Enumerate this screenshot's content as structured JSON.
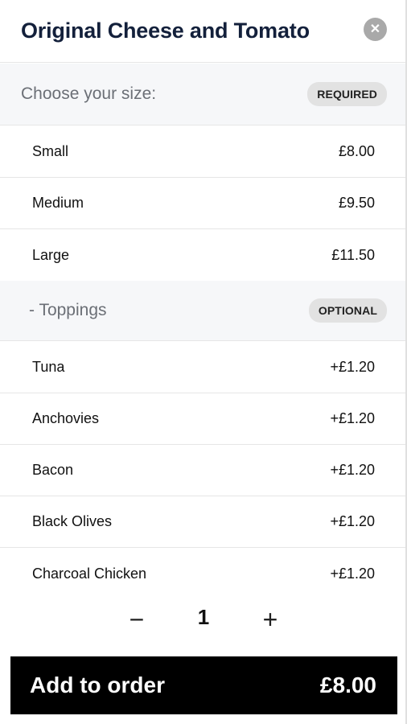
{
  "header": {
    "title": "Original Cheese and Tomato",
    "close_icon": "close-icon"
  },
  "size_section": {
    "title": "Choose your size:",
    "badge": "REQUIRED",
    "options": [
      {
        "name": "Small",
        "price": "£8.00"
      },
      {
        "name": "Medium",
        "price": "£9.50"
      },
      {
        "name": "Large",
        "price": "£11.50"
      }
    ]
  },
  "toppings_section": {
    "title": "- Toppings",
    "badge": "OPTIONAL",
    "options": [
      {
        "name": "Tuna",
        "price": "+£1.20"
      },
      {
        "name": "Anchovies",
        "price": "+£1.20"
      },
      {
        "name": "Bacon",
        "price": "+£1.20"
      },
      {
        "name": "Black Olives",
        "price": "+£1.20"
      },
      {
        "name": "Charcoal Chicken",
        "price": "+£1.20"
      }
    ]
  },
  "quantity": {
    "minus": "−",
    "value": "1",
    "plus": "+"
  },
  "add_button": {
    "label": "Add to order",
    "price": "£8.00"
  },
  "colors": {
    "title": "#13203b",
    "section_bg": "#f6f7f9",
    "badge_bg": "#e2e2e2",
    "button_bg": "#000000"
  }
}
